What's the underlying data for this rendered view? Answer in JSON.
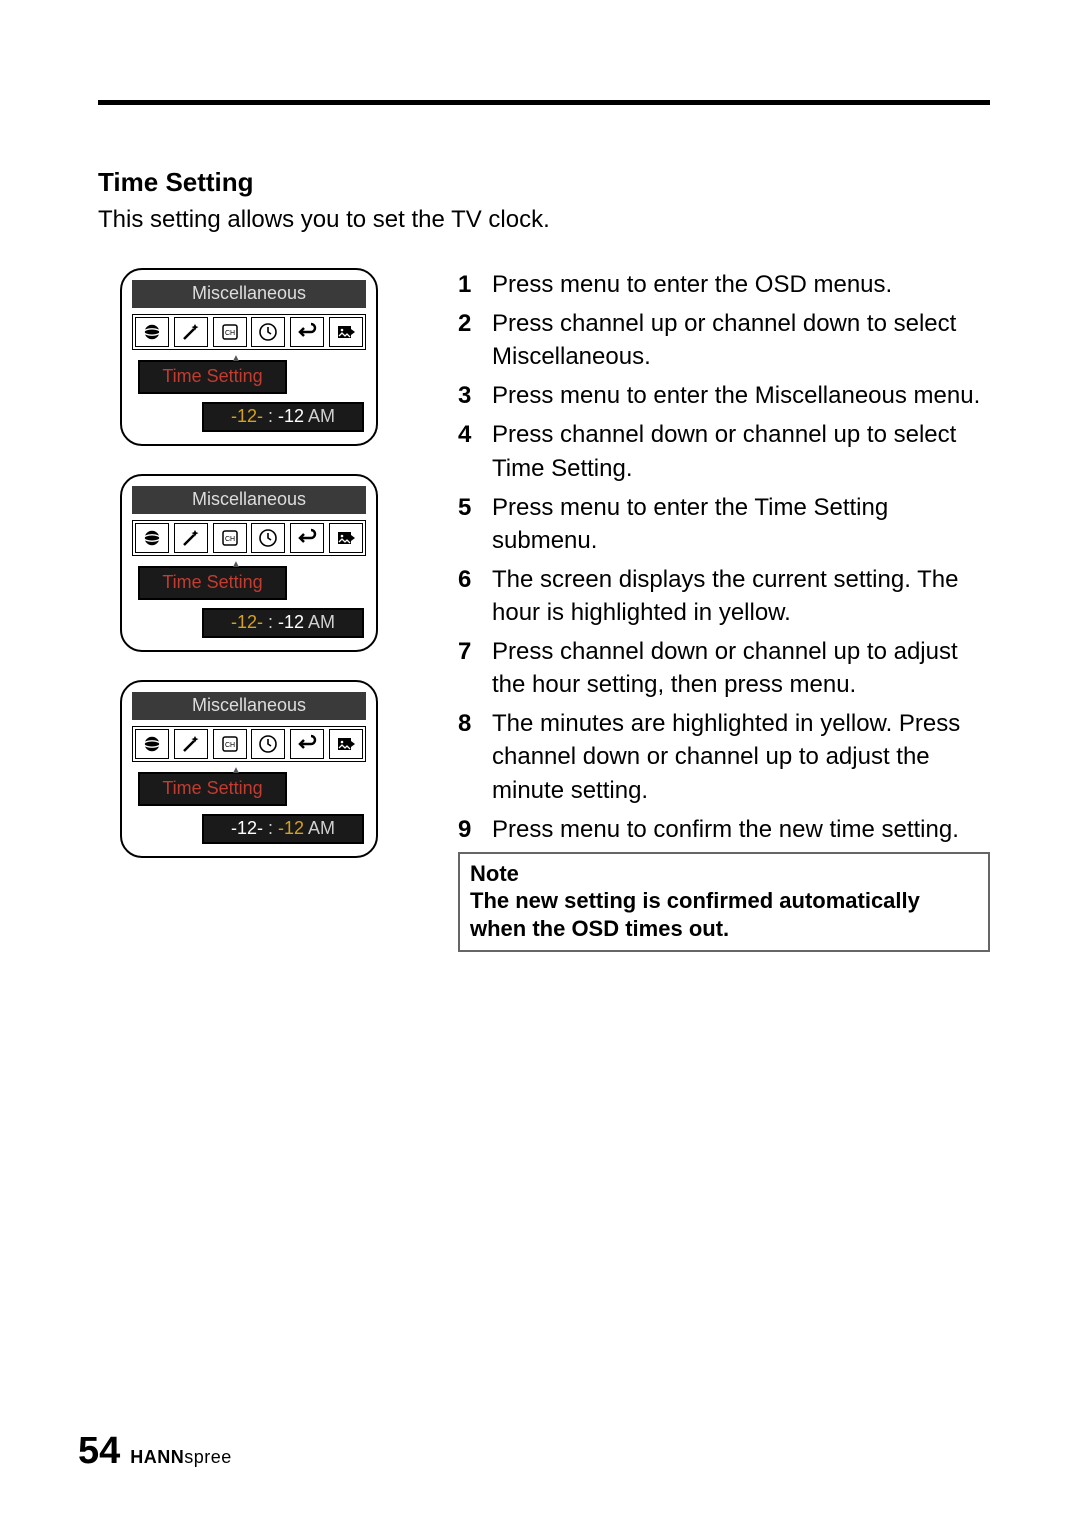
{
  "heading": "Time Setting",
  "intro": "This setting allows you to set the TV clock.",
  "osd": {
    "title": "Miscellaneous",
    "submenu_label": "Time Setting",
    "value_hour": "-12-",
    "value_colon": " : ",
    "value_minute": "-12",
    "value_ampm": " AM",
    "icons": [
      "globe-icon",
      "magic-wand-icon",
      "ch-icon",
      "clock-icon",
      "return-icon",
      "picture-icon"
    ]
  },
  "panels": [
    {
      "highlight_hour": true,
      "highlight_minute": false
    },
    {
      "highlight_hour": true,
      "highlight_minute": false
    },
    {
      "highlight_hour": false,
      "highlight_minute": true
    }
  ],
  "steps": [
    "Press menu to enter the OSD menus.",
    "Press channel up or channel down to select Miscellaneous.",
    "Press menu to enter the Miscellaneous menu.",
    "Press channel down or channel up to select Time Setting.",
    "Press menu to enter the Time Setting submenu.",
    "The screen displays the current setting. The hour is highlighted in yellow.",
    "Press channel down or channel up to adjust the hour setting, then press menu.",
    "The minutes are highlighted in yellow. Press channel down or channel up to adjust the minute setting.",
    "Press menu to confirm the new time setting."
  ],
  "note_label": "Note",
  "note_text": "The new setting is confirmed automatically when the OSD times out.",
  "page_number": "54",
  "brand_bold": "HANN",
  "brand_rest": "spree"
}
